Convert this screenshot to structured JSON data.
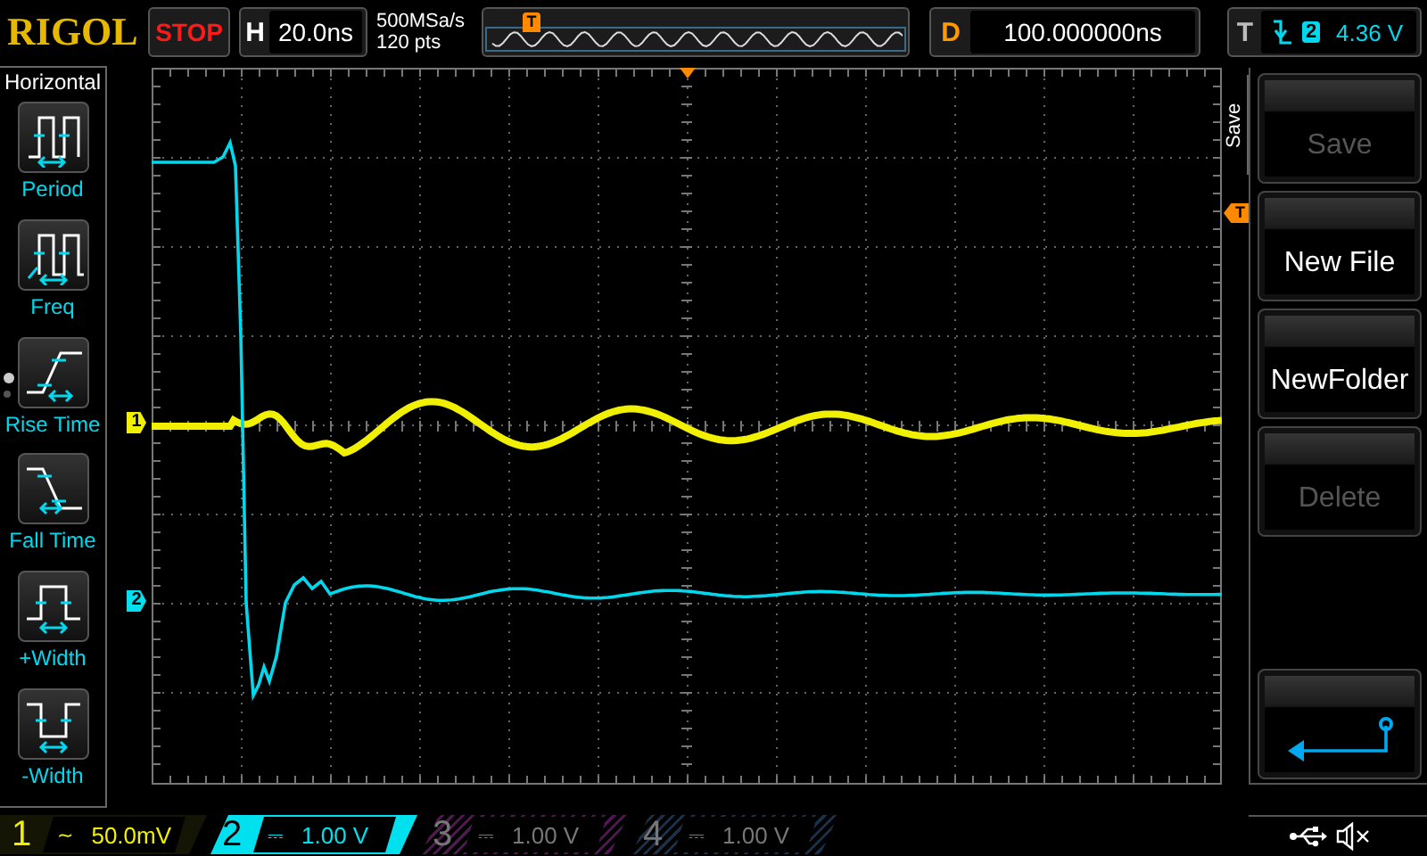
{
  "brand": "RIGOL",
  "run_state": {
    "label": "STOP",
    "running": false
  },
  "timebase": {
    "label": "H",
    "value": "20.0ns"
  },
  "acquisition": {
    "sample_rate": "500MSa/s",
    "memory_depth": "120 pts"
  },
  "overview": {
    "marker": "T"
  },
  "delay": {
    "label": "D",
    "value": "100.000000ns"
  },
  "trigger": {
    "label": "T",
    "source": "2",
    "reading": "4.36 V"
  },
  "measure_menu": {
    "title": "Horizontal",
    "pages": [
      {
        "selected": true
      },
      {
        "selected": false
      }
    ],
    "items": [
      {
        "kind": "period",
        "label": "Period"
      },
      {
        "kind": "freq",
        "label": "Freq"
      },
      {
        "kind": "rise",
        "label": "Rise Time"
      },
      {
        "kind": "fall",
        "label": "Fall Time"
      },
      {
        "kind": "pwidth",
        "label": "+Width"
      },
      {
        "kind": "nwidth",
        "label": "-Width"
      }
    ]
  },
  "plot": {
    "channel_markers": [
      {
        "label": "1",
        "color": "#f0f000"
      },
      {
        "label": "2",
        "color": "#00e0ee"
      }
    ],
    "trigger_marker": "T"
  },
  "soft_menu": {
    "title": "Save",
    "buttons": [
      {
        "kind": "text",
        "label": "Save",
        "disabled": true
      },
      {
        "kind": "text",
        "label": "New File",
        "disabled": false
      },
      {
        "kind": "text",
        "label": "NewFolder",
        "disabled": false
      },
      {
        "kind": "text",
        "label": "Delete",
        "disabled": true
      },
      {
        "kind": "spacer"
      },
      {
        "kind": "back"
      }
    ]
  },
  "channels": [
    {
      "number": "1",
      "coupling": "~",
      "scale": "50.0mV",
      "on": true,
      "selected": false,
      "color": "#f0f000"
    },
    {
      "number": "2",
      "coupling": "⎓",
      "scale": "1.00 V",
      "on": true,
      "selected": true,
      "color": "#00e0ee"
    },
    {
      "number": "3",
      "coupling": "⎓",
      "scale": "1.00 V",
      "on": false,
      "selected": false,
      "color": "#501850"
    },
    {
      "number": "4",
      "coupling": "⎓",
      "scale": "1.00 V",
      "on": false,
      "selected": false,
      "color": "#183048"
    }
  ]
}
